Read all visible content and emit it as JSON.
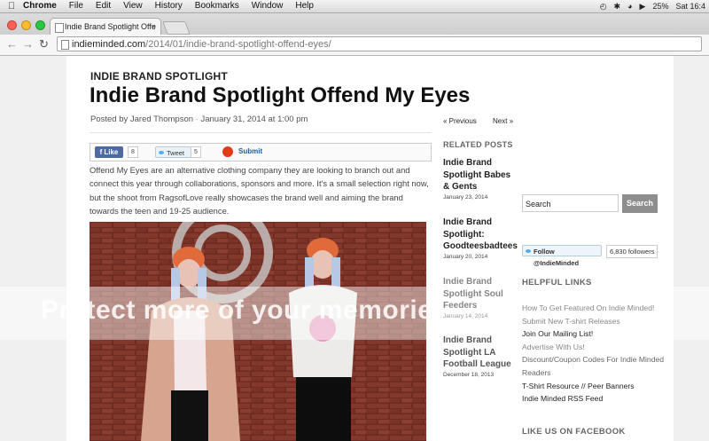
{
  "menubar": {
    "apple_icon": "apple-logo-icon",
    "app": "Chrome",
    "items": [
      "File",
      "Edit",
      "View",
      "History",
      "Bookmarks",
      "Window",
      "Help"
    ],
    "battery": "25%",
    "clock": "Sat 16:4"
  },
  "browser": {
    "tab_title": "Indie Brand Spotlight Offe",
    "url_host": "indieminded.com",
    "url_path": "/2014/01/indie-brand-spotlight-offend-eyes/"
  },
  "post": {
    "category": "INDIE BRAND SPOTLIGHT",
    "title": "Indie Brand Spotlight Offend My Eyes",
    "byline_prefix": "Posted by",
    "author": "Jared Thompson",
    "date": "January 31, 2014 at 1:00 pm",
    "share": {
      "like_label": "Like",
      "like_count": "8",
      "tweet_label": "Tweet",
      "tweet_count": "5",
      "submit_label": "Submit"
    },
    "intro": "Offend My Eyes are an alternative clothing company they are looking to branch out and connect this year through collaborations, sponsors and more. It's a small selection right now, but the shoot from RagsofLove really showcases the brand well and aiming the brand towards the teen and 19-25 audience.",
    "photo_overlay": "Protect more of your memories for less!"
  },
  "related": {
    "prev": "« Previous",
    "next": "Next »",
    "heading": "RELATED POSTS",
    "items": [
      {
        "title": "Indie Brand Spotlight Babes & Gents",
        "date": "January 23, 2014"
      },
      {
        "title": "Indie Brand Spotlight: Goodteesbadtees",
        "date": "January 20, 2014"
      },
      {
        "title": "Indie Brand Spotlight Soul Feeders",
        "date": "January 14, 2014"
      },
      {
        "title": "Indie Brand Spotlight LA Football League",
        "date": "December 18, 2013"
      }
    ]
  },
  "sidebar": {
    "search_placeholder": "Search",
    "search_button": "Search",
    "follow_label": "Follow @IndieMinded",
    "followers": "6,830 followers",
    "helpful_heading": "HELPFUL LINKS",
    "links": [
      "How To Get Featured On Indie Minded!",
      "Submit New T-shirt Releases",
      "Join Our Mailing List!",
      "Advertise With Us!",
      "Discount/Coupon Codes For Indie Minded Readers",
      "T-Shirt Resource // Peer Banners",
      "Indie Minded RSS Feed"
    ],
    "likeus_heading": "LIKE US ON FACEBOOK"
  }
}
